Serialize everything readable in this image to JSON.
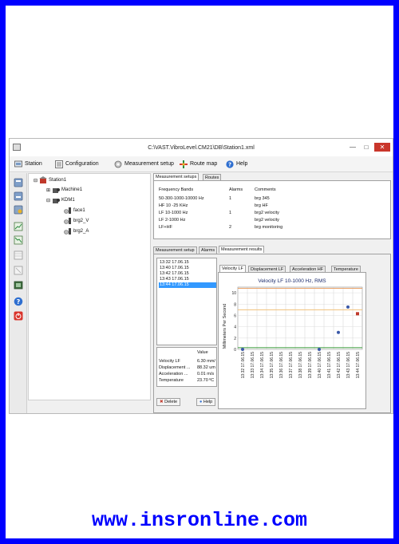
{
  "window": {
    "title": "C:\\VAST.VibroLevel.CM21\\DB\\Station1.xml",
    "controls": {
      "minimize": "—",
      "maximize": "□",
      "close": "✕"
    }
  },
  "toolbar": {
    "station": "Station",
    "configuration": "Configuration",
    "measurement_setup": "Measurement setup",
    "route_map": "Route map",
    "help": "Help"
  },
  "tree": {
    "root": "Station1",
    "machine1": "Machine1",
    "kdm1": "KDM1",
    "points": [
      "face1",
      "brg2_V",
      "brg2_A"
    ]
  },
  "top_tabs": [
    "Measurement setups",
    "Routes"
  ],
  "setups": {
    "headers": [
      "Frequency Bands",
      "Alarms",
      "Comments"
    ],
    "rows": [
      [
        "50-300-1000-10000 Hz",
        "1",
        "brg 345"
      ],
      [
        "HF 10 -25 KHz",
        "",
        "brg HF"
      ],
      [
        "LF 10-1000 Hz",
        "1",
        "brg2 velocity"
      ],
      [
        "LF 2-1000 Hz",
        "",
        "brg2 velocity"
      ],
      [
        "LF+HF",
        "2",
        "brg monitoring"
      ]
    ]
  },
  "bottom_tabs": [
    "Measurement setup",
    "Alarms",
    "Measurement results"
  ],
  "dates": [
    "13:32 17.06.15",
    "13:40 17.06.15",
    "13:42 17.06.15",
    "13:43 17.06.15",
    "13:44 17.06.15"
  ],
  "values": {
    "header": "Value",
    "rows": [
      [
        "Velocity LF",
        "6.30 mm/"
      ],
      [
        "Displacement ...",
        "88.32 um"
      ],
      [
        "Acceleration ...",
        "0.01 m/s"
      ],
      [
        "Temperature",
        "23.70 ºC"
      ]
    ]
  },
  "buttons": {
    "delete": "Delete",
    "help": "Help"
  },
  "chart_tabs": [
    "Velocity LF",
    "Displacement LF",
    "Acceleration HF",
    "Temperature"
  ],
  "chart_data": {
    "type": "scatter",
    "title": "Velocity LF 10-1000 Hz, RMS",
    "ylabel": "Millimeters Per Second",
    "ylim": [
      0,
      11
    ],
    "yticks": [
      "0",
      "2",
      "4",
      "6",
      "8",
      "10"
    ],
    "categories": [
      "13:32 17.06.15",
      "13:33 17.06.15",
      "13:34 17.06.15",
      "13:35 17.06.15",
      "13:36 17.06.15",
      "13:37 17.06.15",
      "13:38 17.06.15",
      "13:39 17.06.15",
      "13:40 17.06.15",
      "13:41 17.06.15",
      "13:42 17.06.15",
      "13:43 17.06.15",
      "13:44 17.06.15"
    ],
    "points": [
      {
        "x": "13:32 17.06.15",
        "y": 0,
        "color": "#3a58a8"
      },
      {
        "x": "13:40 17.06.15",
        "y": 0,
        "color": "#3a58a8"
      },
      {
        "x": "13:42 17.06.15",
        "y": 3,
        "color": "#3a58a8"
      },
      {
        "x": "13:43 17.06.15",
        "y": 7.5,
        "color": "#3a58a8"
      },
      {
        "x": "13:44 17.06.15",
        "y": 6.3,
        "color": "#c0392b"
      }
    ],
    "thresholds": [
      {
        "y": 10.8,
        "color": "#e89a5a"
      },
      {
        "y": 7,
        "color": "#f0c078"
      },
      {
        "y": 0.3,
        "color": "#3a9a3a"
      }
    ],
    "grid": true
  },
  "footer": {
    "text": "www.insronline.com"
  }
}
